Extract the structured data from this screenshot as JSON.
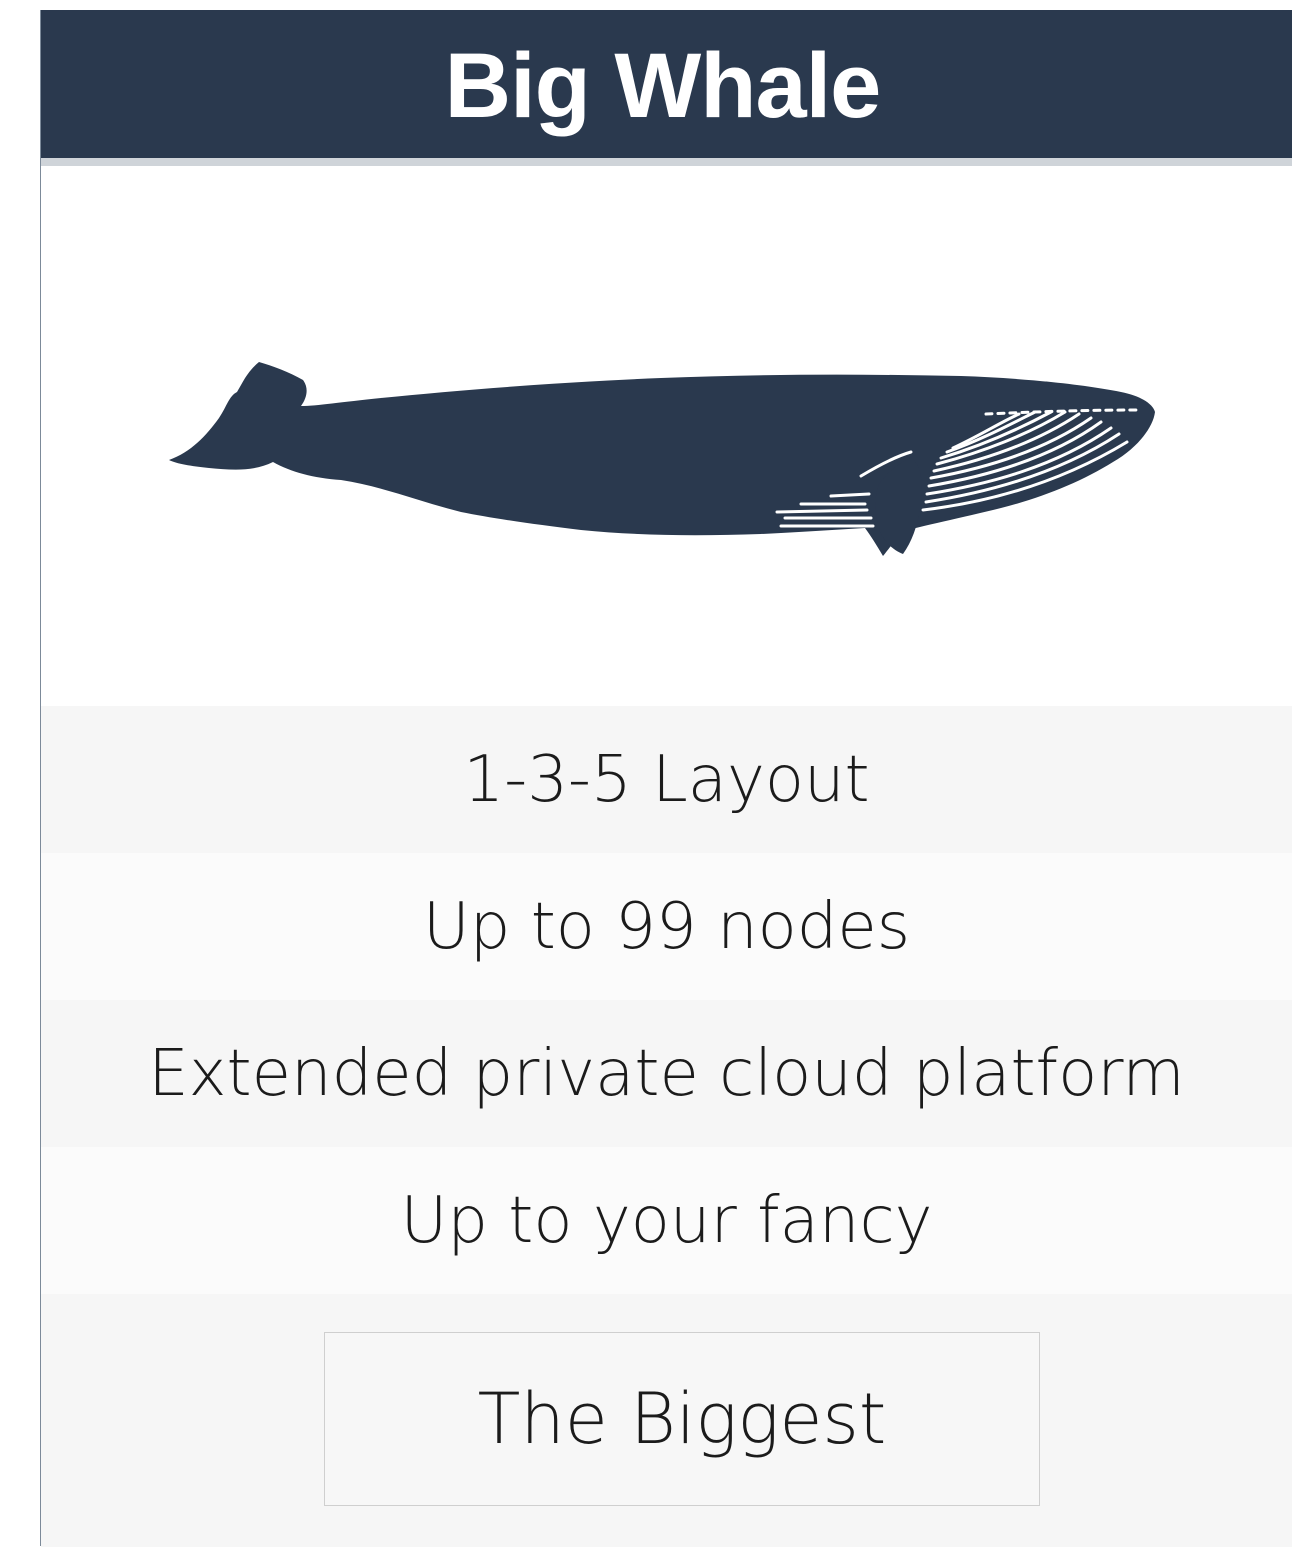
{
  "card": {
    "title": "Big Whale",
    "icon": "whale-icon",
    "colors": {
      "header_bg": "#2a394e",
      "whale": "#2a394e",
      "row_odd": "#f6f6f6",
      "row_even": "#fbfbfb"
    }
  },
  "features": [
    "1-3-5 Layout",
    "Up to 99 nodes",
    "Extended private cloud platform",
    "Up to your fancy"
  ],
  "cta": {
    "label": "The Biggest"
  }
}
